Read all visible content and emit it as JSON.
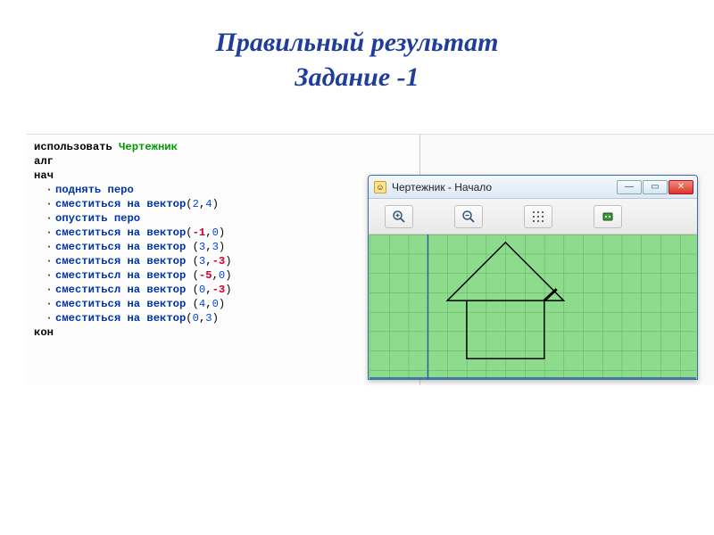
{
  "title_line1": "Правильный результат",
  "title_line2": "Задание -1",
  "code": {
    "use_kw": "использовать",
    "module": "Чертежник",
    "alg": "алг",
    "begin": "нач",
    "end": "кон",
    "pen_up": "поднять перо",
    "pen_down": "опустить перо",
    "move_cmd": "сместиться на вектор",
    "move_cmd_alt": "сместитьсл на вектор",
    "lines": [
      {
        "cmd": "pen_up"
      },
      {
        "cmd": "move",
        "a": "2",
        "b": "4"
      },
      {
        "cmd": "pen_down"
      },
      {
        "cmd": "move",
        "a": "-1",
        "b": "0",
        "sp": false
      },
      {
        "cmd": "move",
        "a": "3",
        "b": "3",
        "sp": true
      },
      {
        "cmd": "move",
        "a": "3",
        "b": "-3",
        "sp": true
      },
      {
        "cmd": "move_alt",
        "a": "-5",
        "b": "0",
        "sp": true
      },
      {
        "cmd": "move_alt",
        "a": "0",
        "b": "-3",
        "sp": true
      },
      {
        "cmd": "move",
        "a": "4",
        "b": "0",
        "sp": true
      },
      {
        "cmd": "move",
        "a": "0",
        "b": "3",
        "sp": false
      }
    ]
  },
  "window": {
    "title": "Чертежник - Начало",
    "min": "—",
    "max": "▭",
    "close": "✕"
  }
}
